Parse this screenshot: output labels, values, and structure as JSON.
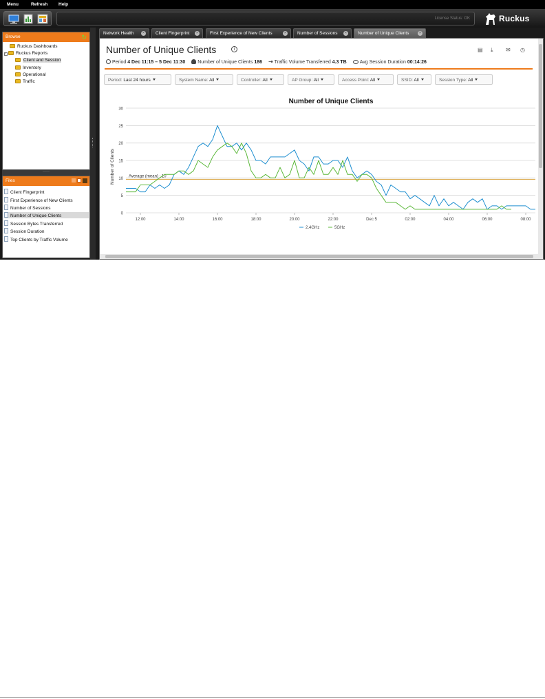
{
  "menu": {
    "items": [
      "Menu",
      "Refresh",
      "Help"
    ]
  },
  "toolbar": {
    "license_status": "License Status: OK",
    "brand": "Ruckus"
  },
  "browse": {
    "title": "Browse",
    "tree": [
      {
        "label": "Ruckus Dashboards",
        "level": 1
      },
      {
        "label": "Ruckus Reports",
        "level": 0
      },
      {
        "label": "Client and Session",
        "level": 2,
        "selected": true
      },
      {
        "label": "Inventory",
        "level": 2
      },
      {
        "label": "Operational",
        "level": 2
      },
      {
        "label": "Traffic",
        "level": 2
      }
    ]
  },
  "files": {
    "title": "Files",
    "items": [
      {
        "label": "Client Fingerprint"
      },
      {
        "label": "First Experience of New Clients"
      },
      {
        "label": "Number of Sessions"
      },
      {
        "label": "Number of Unique Clients",
        "selected": true
      },
      {
        "label": "Session Bytes Transferred"
      },
      {
        "label": "Session Duration"
      },
      {
        "label": "Top Clients by Traffic Volume"
      }
    ]
  },
  "tabs": [
    {
      "label": "Network Health"
    },
    {
      "label": "Client Fingerprint"
    },
    {
      "label": "First Experience of New Clients"
    },
    {
      "label": "Number of Sessions"
    },
    {
      "label": "Number of Unique Clients",
      "active": true
    }
  ],
  "report": {
    "title": "Number of Unique Clients",
    "period_label": "Period",
    "period_value": "4 Dec 11:15 – 5 Dec 11:30",
    "unique_label": "Number of Unique Clients",
    "unique_value": "186",
    "traffic_label": "Traffic Volume Transferred",
    "traffic_value": "4.3 TB",
    "duration_label": "Avg Session Duration",
    "duration_value": "00:14:26"
  },
  "filters": [
    {
      "label": "Period:",
      "value": "Last 24 hours"
    },
    {
      "label": "System Name:",
      "value": "All"
    },
    {
      "label": "Controller:",
      "value": "All"
    },
    {
      "label": "AP Group:",
      "value": "All"
    },
    {
      "label": "Access Point:",
      "value": "All"
    },
    {
      "label": "SSID:",
      "value": "All"
    },
    {
      "label": "Session Type:",
      "value": "All"
    }
  ],
  "colors": {
    "accent": "#ee7b1b",
    "series_24": "#1f8fd0",
    "series_5": "#5cb83a",
    "avg_line": "#d9a441"
  },
  "chart_data": {
    "type": "line",
    "title": "Number of Unique Clients",
    "ylabel": "Number of Clients",
    "xlabel": "",
    "ylim": [
      0,
      30
    ],
    "yticks": [
      0,
      5,
      10,
      15,
      20,
      25,
      30
    ],
    "xlim": [
      11.25,
      32.5
    ],
    "xticks": [
      {
        "label": "12:00",
        "x": 12
      },
      {
        "label": "14:00",
        "x": 14
      },
      {
        "label": "16:00",
        "x": 16
      },
      {
        "label": "18:00",
        "x": 18
      },
      {
        "label": "20:00",
        "x": 20
      },
      {
        "label": "22:00",
        "x": 22
      },
      {
        "label": "Dec 5",
        "x": 24
      },
      {
        "label": "02:00",
        "x": 26
      },
      {
        "label": "04:00",
        "x": 28
      },
      {
        "label": "06:00",
        "x": 30
      },
      {
        "label": "08:00",
        "x": 32
      }
    ],
    "average": {
      "label": "Average (mean) : 10",
      "value": 10
    },
    "series": [
      {
        "name": "2.4GHz",
        "points": [
          [
            11.25,
            7
          ],
          [
            11.75,
            7
          ],
          [
            12,
            6
          ],
          [
            12.25,
            6
          ],
          [
            12.5,
            8
          ],
          [
            12.75,
            7
          ],
          [
            13,
            8
          ],
          [
            13.25,
            7
          ],
          [
            13.5,
            8
          ],
          [
            13.75,
            11
          ],
          [
            14,
            12
          ],
          [
            14.25,
            11
          ],
          [
            14.5,
            13
          ],
          [
            14.75,
            16
          ],
          [
            15,
            19
          ],
          [
            15.25,
            20
          ],
          [
            15.5,
            19
          ],
          [
            15.75,
            21
          ],
          [
            16,
            25
          ],
          [
            16.25,
            22
          ],
          [
            16.5,
            19
          ],
          [
            16.75,
            19
          ],
          [
            17,
            20
          ],
          [
            17.25,
            18
          ],
          [
            17.5,
            20
          ],
          [
            17.75,
            18
          ],
          [
            18,
            15
          ],
          [
            18.25,
            15
          ],
          [
            18.5,
            14
          ],
          [
            18.75,
            16
          ],
          [
            19,
            16
          ],
          [
            19.5,
            16
          ],
          [
            19.75,
            17
          ],
          [
            20,
            18
          ],
          [
            20.25,
            15
          ],
          [
            20.5,
            14
          ],
          [
            20.75,
            12
          ],
          [
            21,
            16
          ],
          [
            21.25,
            16
          ],
          [
            21.5,
            14
          ],
          [
            21.75,
            14
          ],
          [
            22,
            15
          ],
          [
            22.25,
            15
          ],
          [
            22.5,
            13
          ],
          [
            22.75,
            16
          ],
          [
            23,
            12
          ],
          [
            23.25,
            10
          ],
          [
            23.5,
            11
          ],
          [
            23.75,
            12
          ],
          [
            24,
            11
          ],
          [
            24.25,
            9
          ],
          [
            24.5,
            8
          ],
          [
            24.75,
            5
          ],
          [
            25,
            8
          ],
          [
            25.25,
            7
          ],
          [
            25.5,
            6
          ],
          [
            25.75,
            6
          ],
          [
            26,
            4
          ],
          [
            26.25,
            5
          ],
          [
            26.5,
            4
          ],
          [
            26.75,
            3
          ],
          [
            27,
            2
          ],
          [
            27.25,
            5
          ],
          [
            27.5,
            2
          ],
          [
            27.75,
            4
          ],
          [
            28,
            2
          ],
          [
            28.25,
            3
          ],
          [
            28.5,
            2
          ],
          [
            28.75,
            1
          ],
          [
            29,
            3
          ],
          [
            29.25,
            4
          ],
          [
            29.5,
            3
          ],
          [
            29.75,
            4
          ],
          [
            30,
            1
          ],
          [
            30.25,
            2
          ],
          [
            30.5,
            2
          ],
          [
            30.75,
            1
          ],
          [
            31,
            2
          ],
          [
            31.5,
            2
          ],
          [
            32,
            2
          ],
          [
            32.25,
            1
          ],
          [
            32.5,
            1
          ]
        ]
      },
      {
        "name": "5GHz",
        "points": [
          [
            11.25,
            6
          ],
          [
            11.75,
            6
          ],
          [
            12,
            8
          ],
          [
            12.25,
            8
          ],
          [
            12.5,
            8
          ],
          [
            12.75,
            9
          ],
          [
            13,
            10
          ],
          [
            13.25,
            11
          ],
          [
            13.5,
            11
          ],
          [
            13.75,
            11
          ],
          [
            14,
            12
          ],
          [
            14.25,
            12
          ],
          [
            14.5,
            11
          ],
          [
            14.75,
            12
          ],
          [
            15,
            15
          ],
          [
            15.25,
            14
          ],
          [
            15.5,
            13
          ],
          [
            15.75,
            16
          ],
          [
            16,
            18
          ],
          [
            16.25,
            19
          ],
          [
            16.5,
            20
          ],
          [
            16.75,
            19
          ],
          [
            17,
            17
          ],
          [
            17.25,
            20
          ],
          [
            17.5,
            17
          ],
          [
            17.75,
            12
          ],
          [
            18,
            10
          ],
          [
            18.25,
            10
          ],
          [
            18.5,
            11
          ],
          [
            18.75,
            10
          ],
          [
            19,
            10
          ],
          [
            19.25,
            13
          ],
          [
            19.5,
            10
          ],
          [
            19.75,
            11
          ],
          [
            20,
            15
          ],
          [
            20.25,
            10
          ],
          [
            20.5,
            10
          ],
          [
            20.75,
            13
          ],
          [
            21,
            11
          ],
          [
            21.25,
            15
          ],
          [
            21.5,
            11
          ],
          [
            21.75,
            11
          ],
          [
            22,
            13
          ],
          [
            22.25,
            11
          ],
          [
            22.5,
            15
          ],
          [
            22.75,
            11
          ],
          [
            23,
            11
          ],
          [
            23.25,
            9
          ],
          [
            23.5,
            11
          ],
          [
            23.75,
            11
          ],
          [
            24,
            10
          ],
          [
            24.25,
            7
          ],
          [
            24.5,
            5
          ],
          [
            24.75,
            3
          ],
          [
            25,
            3
          ],
          [
            25.25,
            3
          ],
          [
            25.5,
            2
          ],
          [
            25.75,
            1
          ],
          [
            26,
            2
          ],
          [
            26.25,
            1
          ],
          [
            26.5,
            1
          ],
          [
            27,
            1
          ],
          [
            27.5,
            1
          ],
          [
            28,
            1
          ],
          [
            28.5,
            1
          ],
          [
            29,
            1
          ],
          [
            29.5,
            1
          ],
          [
            30,
            1
          ],
          [
            30.5,
            1
          ],
          [
            30.75,
            2
          ],
          [
            31,
            1
          ],
          [
            31.25,
            1
          ]
        ]
      }
    ]
  }
}
